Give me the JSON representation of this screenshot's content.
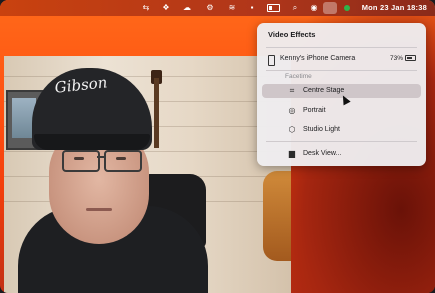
{
  "menubar": {
    "clock": "Mon 23 Jan  18:38",
    "icons": [
      "control-icon",
      "dropbox-icon",
      "cloud-icon",
      "gear-icon",
      "wifi-icon",
      "battery-icon",
      "search-icon",
      "siri-icon",
      "video-effects-icon",
      "status-dot-icon"
    ]
  },
  "background": {
    "cap_logo_text": "Gibson"
  },
  "panel": {
    "title": "Video Effects",
    "device": {
      "name": "Kenny's iPhone Camera",
      "battery": "73%"
    },
    "section_label": "Facetime",
    "items": [
      {
        "label": "Centre Stage",
        "icon": "centre-stage-icon",
        "active": true
      },
      {
        "label": "Portrait",
        "icon": "portrait-icon",
        "active": false
      },
      {
        "label": "Studio Light",
        "icon": "studio-light-icon",
        "active": false
      }
    ],
    "desk_view_label": "Desk View..."
  },
  "colors": {
    "wallpaper": "#ff5a12",
    "panel_bg": "#eeeced",
    "active_row": "#cfc6c9"
  }
}
